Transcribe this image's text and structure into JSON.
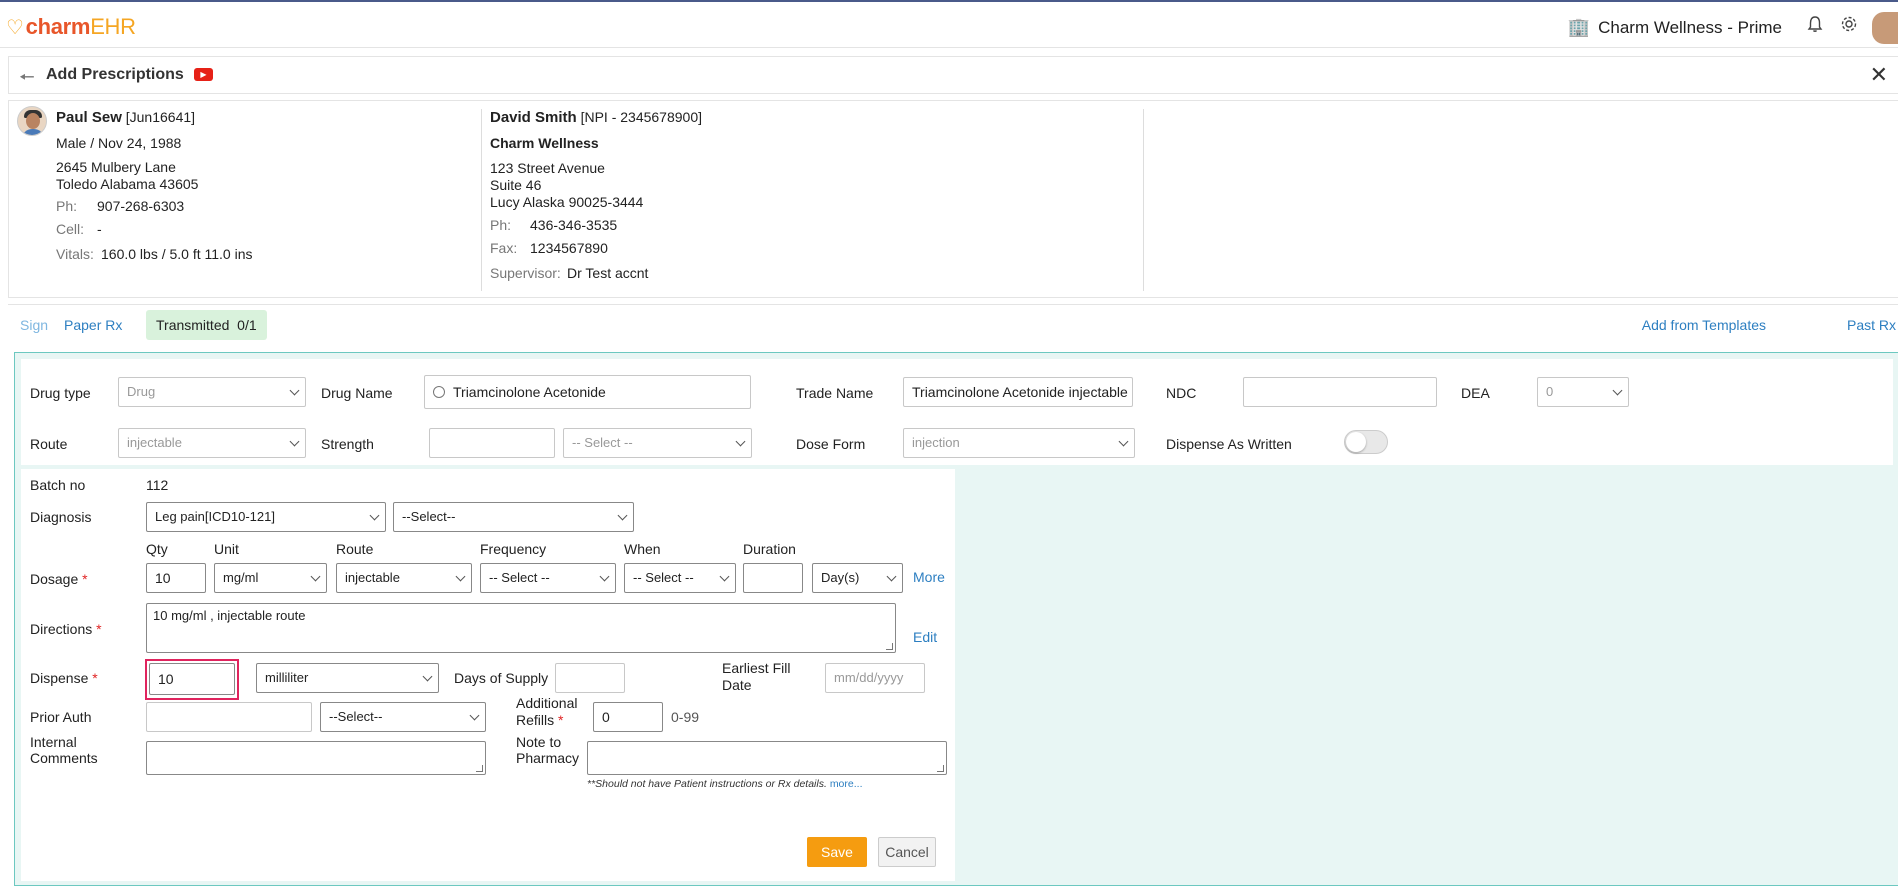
{
  "header": {
    "logo_main": "charm",
    "logo_suffix": "EHR",
    "facility": "Charm Wellness - Prime",
    "icons": [
      "building-icon",
      "bell-icon",
      "gear-icon"
    ]
  },
  "title_bar": {
    "title": "Add Prescriptions"
  },
  "patient": {
    "name": "Paul Sew",
    "id": "[Jun16641]",
    "gender_dob": "Male / Nov 24, 1988",
    "address1": "2645 Mulbery Lane",
    "address2": "Toledo Alabama 43605",
    "ph_label": "Ph:",
    "ph": "907-268-6303",
    "cell_label": "Cell:",
    "cell": "-",
    "vitals_label": "Vitals:",
    "vitals": "160.0 lbs / 5.0 ft 11.0 ins"
  },
  "provider": {
    "name": "David Smith",
    "npi": "[NPI - 2345678900]",
    "clinic": "Charm Wellness",
    "address1": "123 Street Avenue",
    "address2": "Suite 46",
    "address3": "Lucy Alaska 90025-3444",
    "ph_label": "Ph:",
    "ph": "436-346-3535",
    "fax_label": "Fax:",
    "fax": "1234567890",
    "supervisor_label": "Supervisor:",
    "supervisor": "Dr Test accnt"
  },
  "tabs": {
    "sign": "Sign",
    "paper_rx": "Paper Rx",
    "transmitted": "Transmitted",
    "transmitted_count": "0/1",
    "add_from_templates": "Add from Templates",
    "past_rx": "Past Rx"
  },
  "drug": {
    "drug_type_label": "Drug type",
    "drug_type_value": "Drug",
    "drug_name_label": "Drug Name",
    "drug_name_value": "Triamcinolone Acetonide",
    "trade_name_label": "Trade Name",
    "trade_name_value": "Triamcinolone Acetonide injectable",
    "ndc_label": "NDC",
    "ndc_value": "",
    "dea_label": "DEA",
    "dea_value": "0",
    "route_label": "Route",
    "route_value": "injectable",
    "strength_label": "Strength",
    "strength_value": "",
    "strength_unit": "-- Select --",
    "dose_form_label": "Dose Form",
    "dose_form_value": "injection",
    "daw_label": "Dispense As Written",
    "daw_on": false
  },
  "rx": {
    "batch_label": "Batch no",
    "batch_value": "112",
    "diagnosis_label": "Diagnosis",
    "diagnosis_value": "Leg pain[ICD10-121]",
    "diagnosis2_value": "--Select--",
    "dosage_label": "Dosage",
    "qty_label": "Qty",
    "qty_value": "10",
    "unit_label": "Unit",
    "unit_value": "mg/ml",
    "route_label": "Route",
    "route_value": "injectable",
    "frequency_label": "Frequency",
    "frequency_value": "-- Select --",
    "when_label": "When",
    "when_value": "-- Select --",
    "duration_label": "Duration",
    "duration_value": "",
    "duration_unit": "Day(s)",
    "more_link": "More",
    "directions_label": "Directions",
    "directions_value": "10 mg/ml , injectable route",
    "edit_link": "Edit",
    "dispense_label": "Dispense",
    "dispense_value": "10",
    "dispense_unit": "milliliter",
    "days_supply_label": "Days of Supply",
    "days_supply_value": "",
    "earliest_fill_label_1": "Earliest Fill",
    "earliest_fill_label_2": "Date",
    "earliest_fill_placeholder": "mm/dd/yyyy",
    "prior_auth_label": "Prior Auth",
    "prior_auth_value": "",
    "prior_auth_select": "--Select--",
    "additional_refills_label_1": "Additional",
    "additional_refills_label_2": "Refills",
    "additional_refills_value": "0",
    "refills_range": "0-99",
    "internal_comments_label_1": "Internal",
    "internal_comments_label_2": "Comments",
    "note_pharmacy_label_1": "Note to",
    "note_pharmacy_label_2": "Pharmacy",
    "note_warning": "**Should not have Patient instructions or Rx details.",
    "note_more_link": "more...",
    "save": "Save",
    "cancel": "Cancel"
  },
  "colors": {
    "accent_orange": "#f59c10",
    "link_blue": "#2d7fc1",
    "form_bg": "#e8f6f4",
    "highlight": "#e0245e"
  }
}
